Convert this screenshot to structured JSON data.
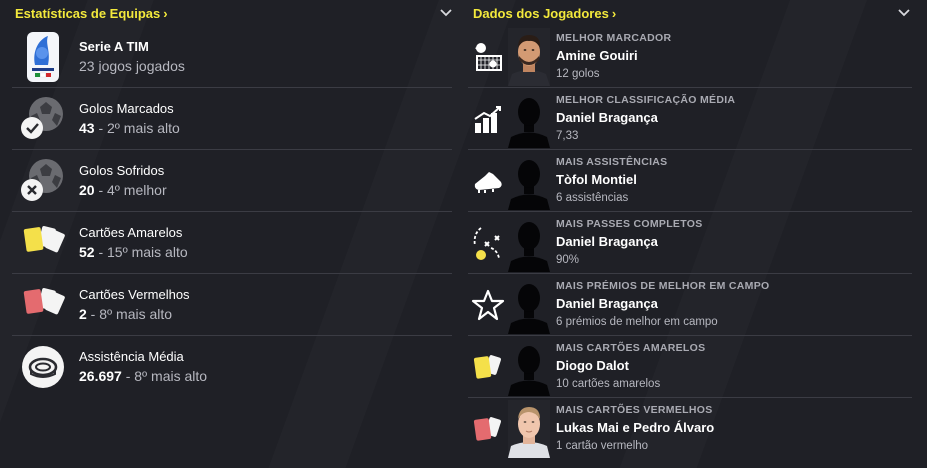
{
  "colors": {
    "accent": "#f3e93c",
    "background": "#1f2026",
    "divider": "#3b3c44"
  },
  "left_panel": {
    "title": "Estatísticas de Equipas",
    "rows": [
      {
        "icon": "serie-a-logo",
        "line1": "Serie A TIM",
        "line2_bold": "",
        "line2": "23 jogos jogados"
      },
      {
        "icon": "ball-check-icon",
        "line1": "Golos Marcados",
        "line2_bold": "43",
        "line2": " - 2º mais alto"
      },
      {
        "icon": "ball-cross-icon",
        "line1": "Golos Sofridos",
        "line2_bold": "20",
        "line2": " - 4º melhor"
      },
      {
        "icon": "yellow-cards-icon",
        "line1": "Cartões Amarelos",
        "line2_bold": "52",
        "line2": " - 15º mais alto"
      },
      {
        "icon": "red-cards-icon",
        "line1": "Cartões Vermelhos",
        "line2_bold": "2",
        "line2": " - 8º mais alto"
      },
      {
        "icon": "stadium-icon",
        "line1": "Assistência Média",
        "line2_bold": "26.697",
        "line2": " - 8º mais alto"
      }
    ]
  },
  "right_panel": {
    "title": "Dados dos Jogadores",
    "rows": [
      {
        "icon": "goal-net-icon",
        "category": "MELHOR MARCADOR",
        "player": "Amine Gouiri",
        "value": "12 golos",
        "face": "photo-dark"
      },
      {
        "icon": "rating-bars-icon",
        "category": "MELHOR CLASSIFICAÇÃO MÉDIA",
        "player": "Daniel Bragança",
        "value": "7,33",
        "face": "silhouette"
      },
      {
        "icon": "boot-icon",
        "category": "MAIS ASSISTÊNCIAS",
        "player": "Tòfol Montiel",
        "value": "6 assistências",
        "face": "silhouette"
      },
      {
        "icon": "passes-icon",
        "category": "MAIS PASSES COMPLETOS",
        "player": "Daniel Bragança",
        "value": "90%",
        "face": "silhouette"
      },
      {
        "icon": "star-icon",
        "category": "MAIS PRÉMIOS DE MELHOR EM CAMPO",
        "player": "Daniel Bragança",
        "value": "6 prémios de melhor em campo",
        "face": "silhouette"
      },
      {
        "icon": "yellow-card-icon",
        "category": "MAIS CARTÕES AMARELOS",
        "player": "Diogo Dalot",
        "value": "10 cartões amarelos",
        "face": "silhouette"
      },
      {
        "icon": "red-card-icon",
        "category": "MAIS CARTÕES VERMELHOS",
        "player": "Lukas Mai e Pedro Álvaro",
        "value": "1 cartão vermelho",
        "face": "photo-light"
      }
    ]
  }
}
